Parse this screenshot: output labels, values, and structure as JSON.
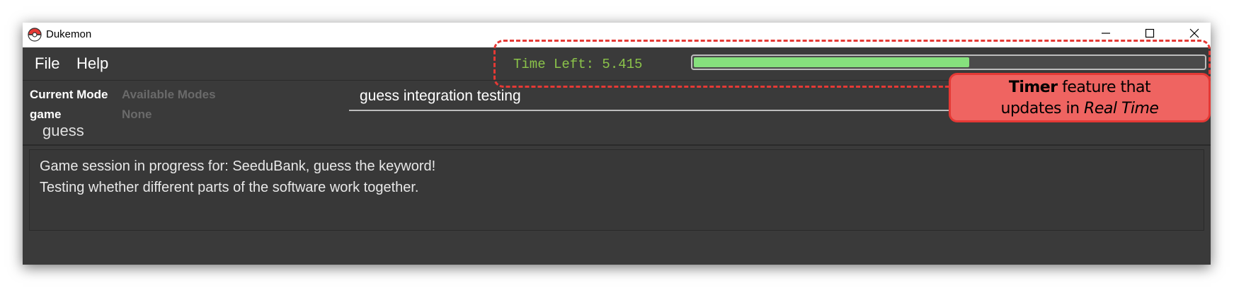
{
  "window": {
    "title": "Dukemon",
    "controls": {
      "minimize": "─",
      "maximize": "☐",
      "close": "✕"
    }
  },
  "menu": {
    "items": [
      "File",
      "Help"
    ]
  },
  "timer": {
    "label": "Time Left: 5.415",
    "progress_fraction": 0.54,
    "fill_color": "#86e07d",
    "text_color": "#8bc34a"
  },
  "mode_panel": {
    "current_mode_title": "Current Mode",
    "current_mode_value": "game",
    "available_modes_title": "Available Modes",
    "available_modes_value": "None"
  },
  "command_box": {
    "text": "guess integration testing"
  },
  "guess_label": "guess",
  "result": {
    "lines": [
      "Game session in progress for: SeeduBank, guess the keyword!",
      "Testing whether different parts of the software work together."
    ]
  },
  "annotation": {
    "bold_part": "Timer",
    "rest_line1": " feature that",
    "line2_prefix": "updates in ",
    "italic_part": "Real Time",
    "color": "#e53935"
  },
  "icons": {
    "app": "pokeball-icon"
  }
}
